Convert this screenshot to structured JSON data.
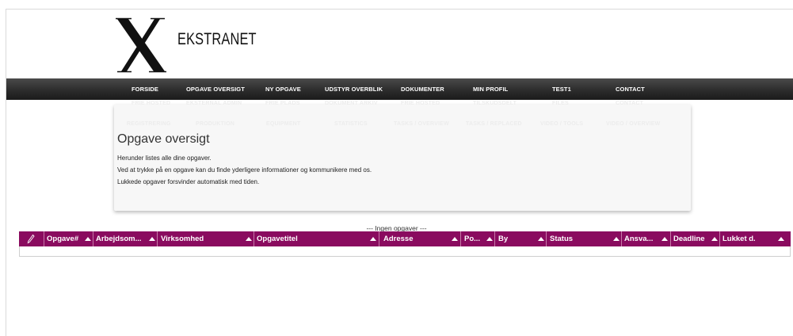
{
  "brand": {
    "logo_letter": "X",
    "name": "EKSTRANET"
  },
  "nav": {
    "items": [
      {
        "id": "forside",
        "label": "FORSIDE"
      },
      {
        "id": "opgave-oversigt",
        "label": "OPGAVE OVERSIGT"
      },
      {
        "id": "ny-opgave",
        "label": "NY OPGAVE"
      },
      {
        "id": "udstyr-overblik",
        "label": "UDSTYR OVERBLIK"
      },
      {
        "id": "dokumenter",
        "label": "DOKUMENTER"
      },
      {
        "id": "min-profil",
        "label": "MIN PROFIL"
      },
      {
        "id": "test1",
        "label": "TEST1"
      },
      {
        "id": "contact",
        "label": "CONTACT"
      }
    ],
    "hidden_row1": [
      "FRIE HOSTED",
      "EKSTERNAL ADMIN",
      "FRIE PLADS",
      "DOKUMENT ARKIV",
      "FRIE HOSTED",
      "TILSKUDSDELT",
      "FILES",
      "CONTACT"
    ],
    "hidden_row2": [
      "REGISTRERING",
      "PRODUKTION",
      "EQUIPMENT",
      "STATISTICS",
      "TASKS / OVERVIEW",
      "TASKS / REPLACED",
      "VIDEO / TOOLS",
      "VIDEO / OVERVIEW"
    ]
  },
  "info": {
    "title": "Opgave oversigt",
    "lines": [
      "Herunder listes alle dine opgaver.",
      "Ved at trykke på en opgave kan du finde yderligere informationer og kommunikere med os.",
      "Lukkede opgaver forsvinder automatisk med tiden."
    ]
  },
  "table": {
    "empty_message": "--- Ingen opgaver ---",
    "columns": [
      {
        "id": "opgave-nr",
        "label": "Opgave#"
      },
      {
        "id": "arbejdsomraade",
        "label": "Arbejdsom..."
      },
      {
        "id": "virksomhed",
        "label": "Virksomhed"
      },
      {
        "id": "opgavetitel",
        "label": "Opgavetitel"
      },
      {
        "id": "adresse",
        "label": "Adresse"
      },
      {
        "id": "postnr",
        "label": "Po..."
      },
      {
        "id": "by",
        "label": "By"
      },
      {
        "id": "status",
        "label": "Status"
      },
      {
        "id": "ansvarlig",
        "label": "Ansva..."
      },
      {
        "id": "deadline",
        "label": "Deadline"
      },
      {
        "id": "lukket-dato",
        "label": "Lukket d."
      }
    ],
    "rows": []
  },
  "colors": {
    "header_bar": "#2c2c2c",
    "table_header": "#8a0b5f",
    "card_bg": "#f7f7f7"
  }
}
